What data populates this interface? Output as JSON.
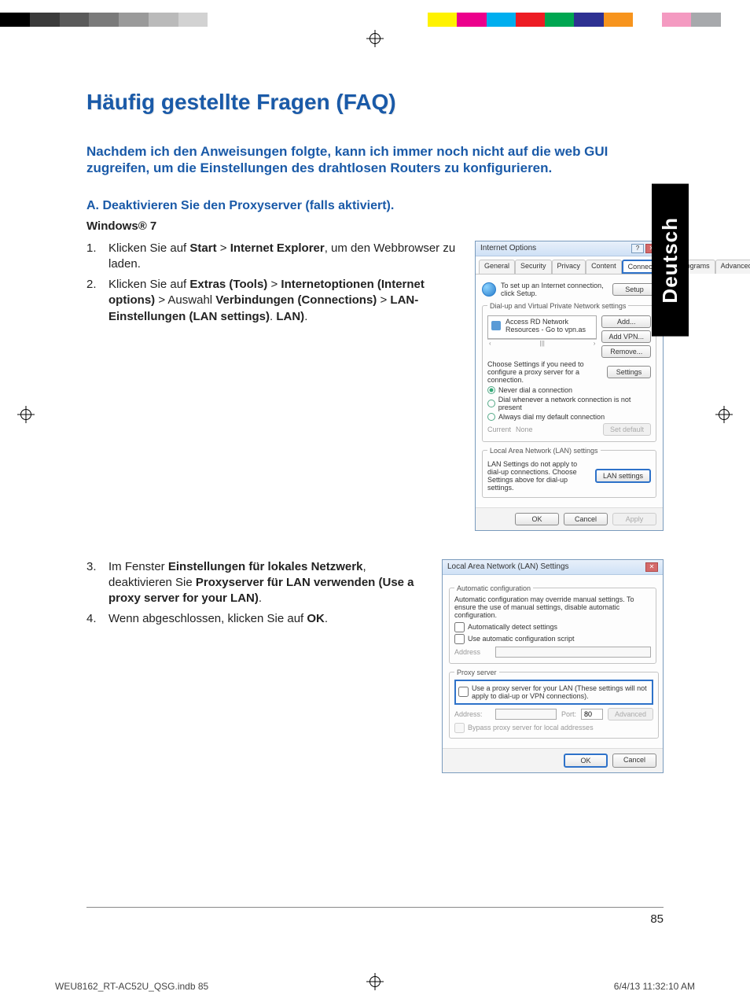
{
  "calibration": {
    "left_grays": [
      "#000000",
      "#3a3a3a",
      "#5a5a5a",
      "#7a7a7a",
      "#9a9a9a",
      "#bababa",
      "#d2d2d2",
      "#ffffff",
      "#ffffff"
    ],
    "right_colors": [
      "#fff200",
      "#ec008c",
      "#00aeef",
      "#ed1c24",
      "#00a651",
      "#2e3192",
      "#f7941d",
      "#ffffff",
      "#f49ac1",
      "#a7a9ac",
      "#ffffff"
    ]
  },
  "language_tab": "Deutsch",
  "title": "Häufig gestellte Fragen (FAQ)",
  "question": "Nachdem ich den Anweisungen folgte, kann ich immer noch nicht auf die web GUI zugreifen, um die Einstellungen des drahtlosen Routers zu konfigurieren.",
  "section_a": "A.   Deaktivieren Sie den Proxyserver (falls aktiviert).",
  "os_label": "Windows® 7",
  "steps_upper": [
    {
      "n": "1.",
      "parts": [
        {
          "t": "Klicken Sie auf "
        },
        {
          "t": "Start",
          "b": true
        },
        {
          "t": " > "
        },
        {
          "t": "Internet Explorer",
          "b": true
        },
        {
          "t": ", um den Webbrowser zu laden."
        }
      ]
    },
    {
      "n": "2.",
      "parts": [
        {
          "t": "Klicken Sie auf "
        },
        {
          "t": "Extras (Tools)",
          "b": true
        },
        {
          "t": " > "
        },
        {
          "t": "Internetoptionen (Internet options)",
          "b": true
        },
        {
          "t": " > Auswahl "
        },
        {
          "t": "Verbindungen (Con­nections)",
          "b": true
        },
        {
          "t": " > "
        },
        {
          "t": "LAN-Einstellungen (LAN settings)",
          "b": true
        },
        {
          "t": ". "
        },
        {
          "t": "LAN)",
          "b": true
        },
        {
          "t": "."
        }
      ]
    }
  ],
  "steps_lower": [
    {
      "n": "3.",
      "parts": [
        {
          "t": "Im Fenster "
        },
        {
          "t": "Einstellungen für lokales Netz­werk",
          "b": true
        },
        {
          "t": ", deaktivieren Sie "
        },
        {
          "t": "Proxyserver für LAN verwenden (Use a proxy server for your LAN)",
          "b": true
        },
        {
          "t": "."
        }
      ]
    },
    {
      "n": "4.",
      "parts": [
        {
          "t": "Wenn abgeschlossen, klicken Sie auf "
        },
        {
          "t": "OK",
          "b": true
        },
        {
          "t": "."
        }
      ]
    }
  ],
  "dialog1": {
    "title": "Internet Options",
    "tabs": [
      "General",
      "Security",
      "Privacy",
      "Content",
      "Connections",
      "Programs",
      "Advanced"
    ],
    "active_tab_index": 4,
    "setup_text": "To set up an Internet connection, click Setup.",
    "setup_btn": "Setup",
    "dialup_legend": "Dial-up and Virtual Private Network settings",
    "list_item": "Access RD Network Resources - Go to vpn.as",
    "btn_add": "Add...",
    "btn_addvpn": "Add VPN...",
    "btn_remove": "Remove...",
    "choose_text": "Choose Settings if you need to configure a proxy server for a connection.",
    "btn_settings": "Settings",
    "radio1": "Never dial a connection",
    "radio2": "Dial whenever a network connection is not present",
    "radio3": "Always dial my default connection",
    "current_label": "Current",
    "current_value": "None",
    "btn_setdefault": "Set default",
    "lan_legend": "Local Area Network (LAN) settings",
    "lan_text": "LAN Settings do not apply to dial-up connections. Choose Settings above for dial-up settings.",
    "btn_lan": "LAN settings",
    "btn_ok": "OK",
    "btn_cancel": "Cancel",
    "btn_apply": "Apply"
  },
  "dialog2": {
    "title": "Local Area Network (LAN) Settings",
    "auto_legend": "Automatic configuration",
    "auto_text": "Automatic configuration may override manual settings. To ensure the use of manual settings, disable automatic configuration.",
    "auto_detect": "Automatically detect settings",
    "auto_script": "Use automatic configuration script",
    "address_label": "Address",
    "proxy_legend": "Proxy server",
    "proxy_use": "Use a proxy server for your LAN (These settings will not apply to dial-up or VPN connections).",
    "proxy_addr_label": "Address:",
    "proxy_port_label": "Port:",
    "proxy_port_value": "80",
    "btn_advanced": "Advanced",
    "bypass": "Bypass proxy server for local addresses",
    "btn_ok": "OK",
    "btn_cancel": "Cancel"
  },
  "page_number": "85",
  "footer_left": "WEU8162_RT-AC52U_QSG.indb   85",
  "footer_right": "6/4/13   11:32:10 AM"
}
